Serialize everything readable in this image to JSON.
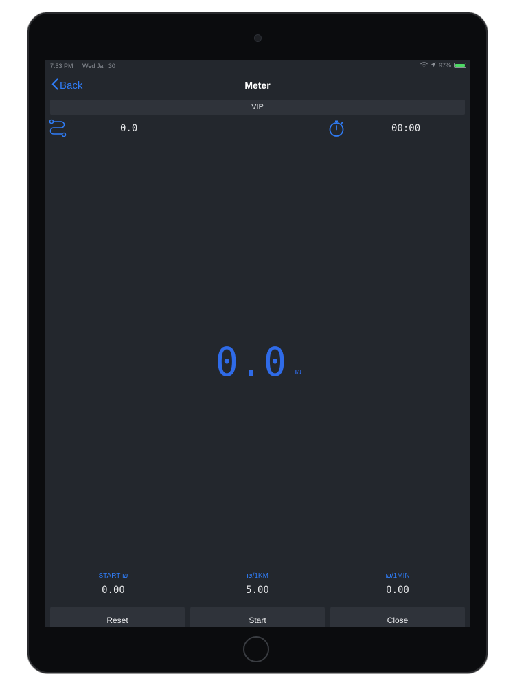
{
  "status_bar": {
    "time": "7:53 PM",
    "date": "Wed Jan 30",
    "battery": "97%",
    "battery_level": 0.97
  },
  "nav": {
    "back_label": "Back",
    "title": "Meter"
  },
  "vip_label": "VIP",
  "trip": {
    "distance": "0.0",
    "duration": "00:00"
  },
  "fare": {
    "amount": "0.0",
    "currency": "₪"
  },
  "rates": {
    "start_label": "START ₪",
    "start_value": "0.00",
    "per_km_label": "₪/1KM",
    "per_km_value": "5.00",
    "per_min_label": "₪/1MIN",
    "per_min_value": "0.00"
  },
  "buttons": {
    "reset": "Reset",
    "start": "Start",
    "close": "Close"
  },
  "colors": {
    "accent": "#2f7cf6",
    "fare": "#2f6be8",
    "background": "#23272d",
    "button": "#2f333a"
  }
}
